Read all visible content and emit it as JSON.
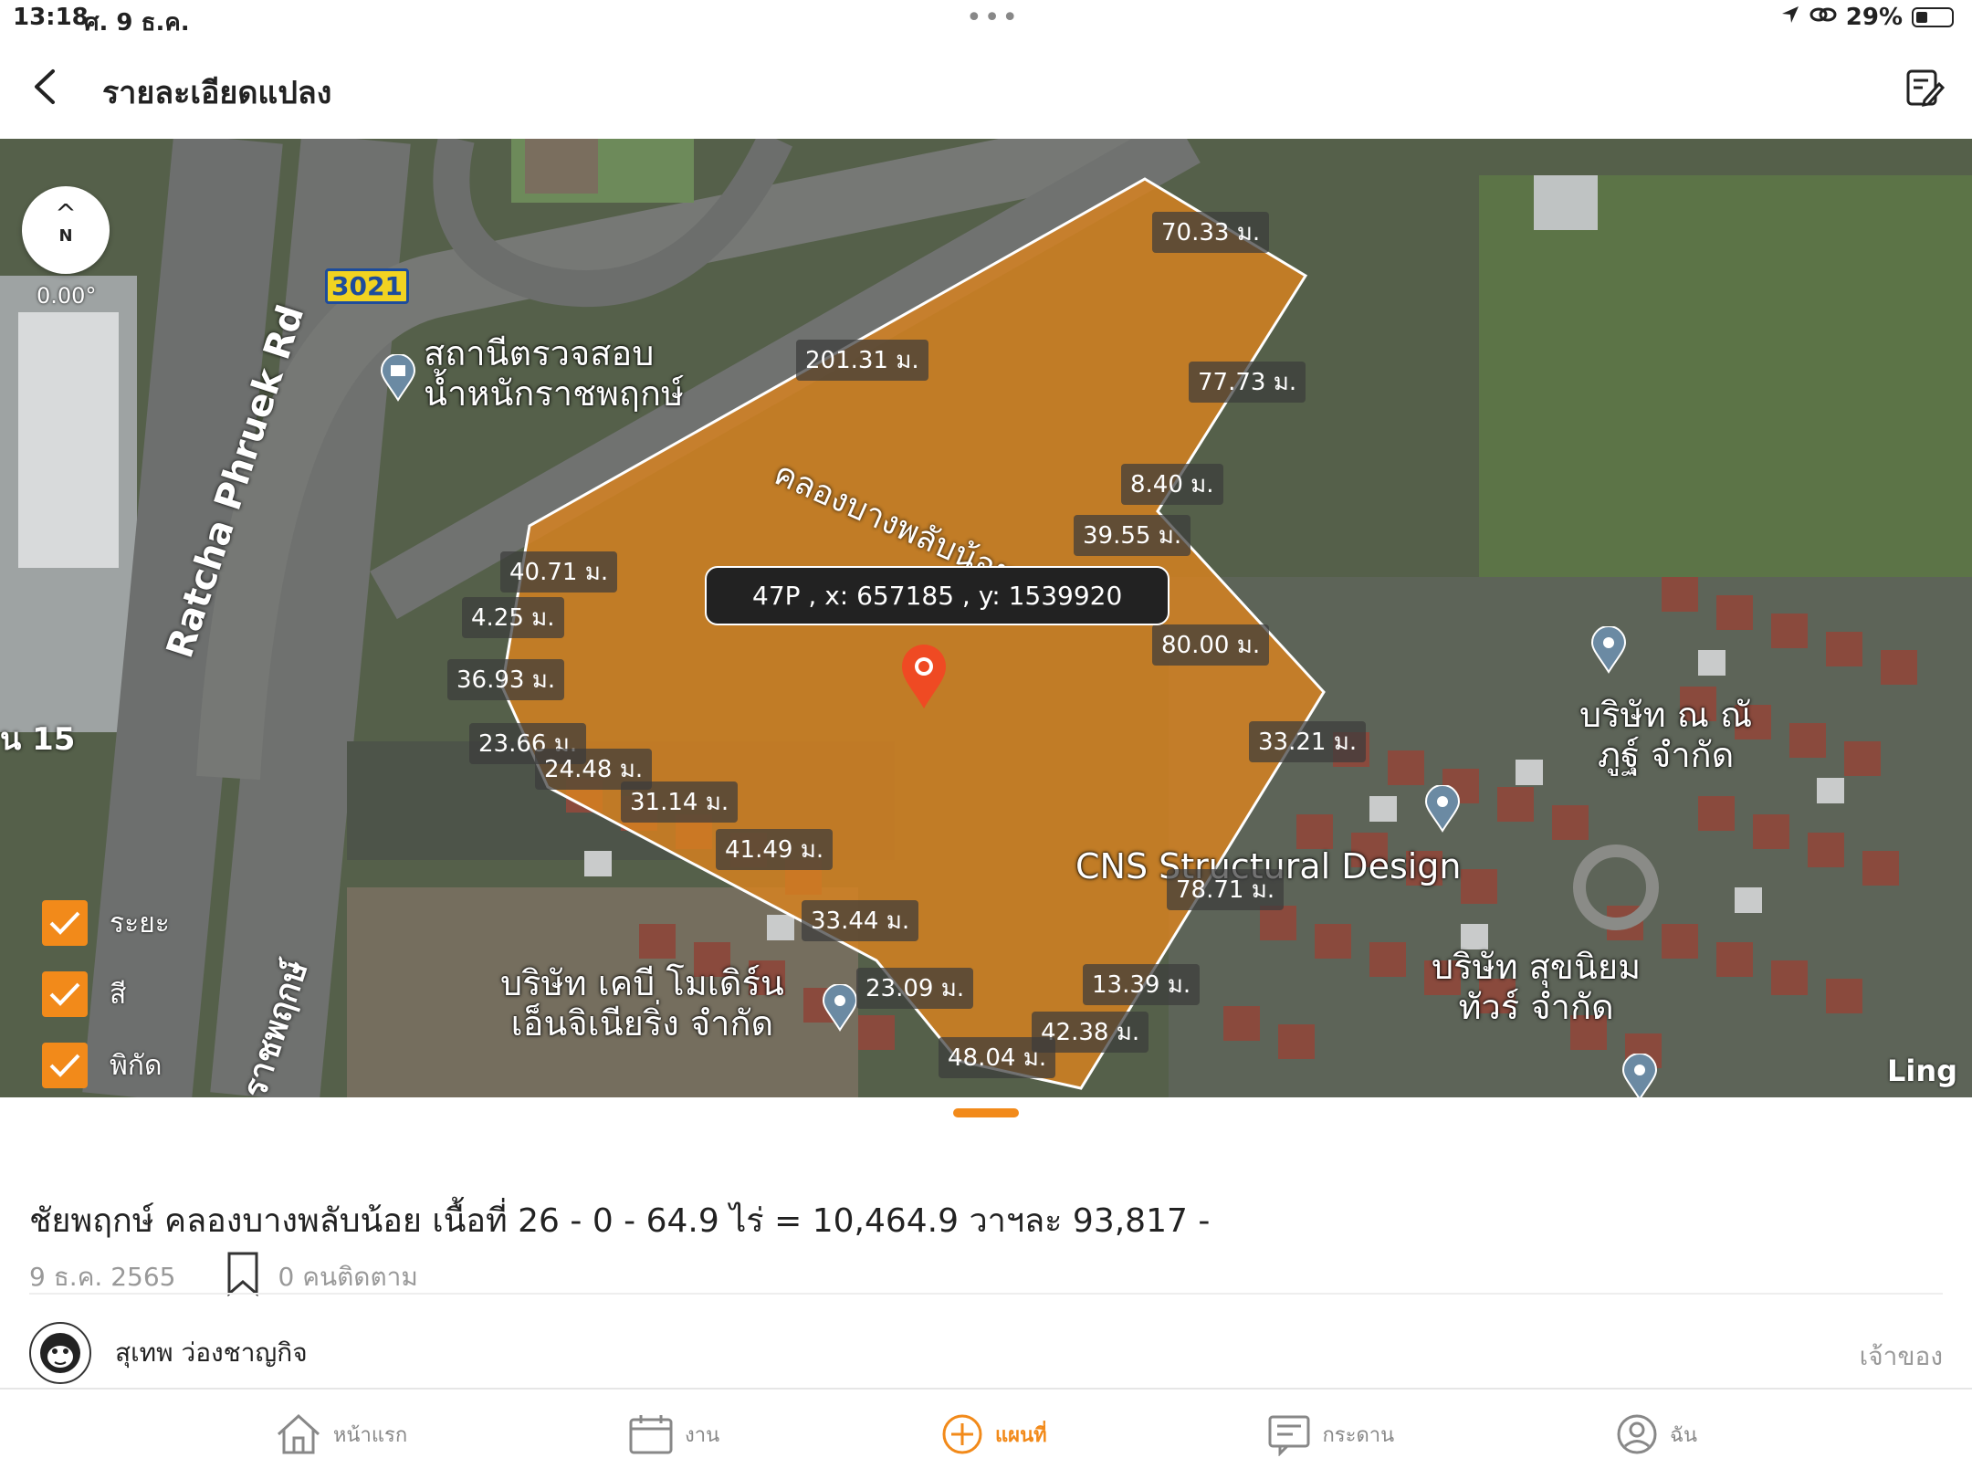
{
  "status": {
    "time": "13:18",
    "date": "ศ. 9 ธ.ค.",
    "battery": "29%",
    "battery_level": 0.29
  },
  "header": {
    "title": "รายละเอียดแปลง"
  },
  "map": {
    "bearing": "0.00°",
    "compass_letter": "N",
    "route_shield": "3021",
    "road_name": "Ratcha Phruek Rd",
    "road_name_thai": "ราชพฤกษ์",
    "road_num": "น 15",
    "canal_name": "คลองบางพลับน้อย",
    "coordinate_popup": "47P , x: 657185 , y: 1539920",
    "watermark": "Ling",
    "pois": {
      "weigh_station_1": "สถานีตรวจสอบ",
      "weigh_station_2": "น้ำหนักราชพฤกษ์",
      "nana_1": "บริษัท ณ ณั",
      "nana_2": "ภูฐ์ จำกัด",
      "cns": "CNS Structural Design",
      "sukniyom_1": "บริษัท สุขนิยม",
      "sukniyom_2": "ทัวร์ จำกัด",
      "kb_1": "บริษัท เคบี โมเดิร์น",
      "kb_2": "เอ็นจิเนียริ่ง จำกัด"
    },
    "distances": [
      "70.33 ม.",
      "77.73 ม.",
      "201.31 ม.",
      "8.40 ม.",
      "39.55 ม.",
      "40.71 ม.",
      "4.25 ม.",
      "80.00 ม.",
      "36.93 ม.",
      "33.21 ม.",
      "23.66 ม.",
      "24.48 ม.",
      "31.14 ม.",
      "41.49 ม.",
      "78.71 ม.",
      "33.44 ม.",
      "23.09 ม.",
      "13.39 ม.",
      "42.38 ม.",
      "48.04 ม."
    ],
    "toggles": [
      {
        "label": "ระยะ",
        "checked": true
      },
      {
        "label": "สี",
        "checked": true
      },
      {
        "label": "พิกัด",
        "checked": true
      }
    ]
  },
  "listing": {
    "title": "ชัยพฤกษ์ คลองบางพลับน้อย เนื้อที่ 26 - 0 - 64.9 ไร่ = 10,464.9 วาฯละ 93,817 -",
    "date": "9 ธ.ค. 2565",
    "followers": "0 คนติดตาม",
    "owner_name": "สุเทพ ว่องชาญกิจ",
    "owner_role": "เจ้าของ"
  },
  "tabs": [
    {
      "label": "หน้าแรก",
      "icon": "home-icon",
      "active": false
    },
    {
      "label": "งาน",
      "icon": "calendar-icon",
      "active": false
    },
    {
      "label": "แผนที่",
      "icon": "add-circle-icon",
      "active": true
    },
    {
      "label": "กระดาน",
      "icon": "board-icon",
      "active": false
    },
    {
      "label": "ฉัน",
      "icon": "profile-icon",
      "active": false
    }
  ],
  "colors": {
    "accent": "#f28a1a",
    "parcel_fill": "#d9821e"
  }
}
